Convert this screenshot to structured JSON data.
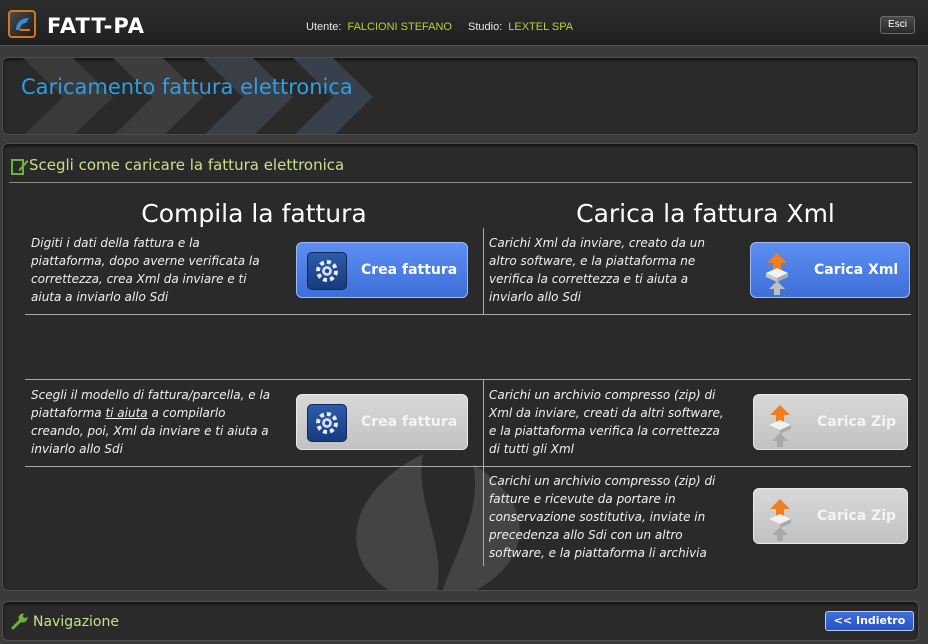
{
  "header": {
    "app_title": "FATT-PA",
    "user_label": "Utente:",
    "user_value": "FALCIONI STEFANO",
    "studio_label": "Studio:",
    "studio_value": "LEXTEL SPA",
    "exit_label": "Esci"
  },
  "page": {
    "title": "Caricamento fattura elettronica"
  },
  "section": {
    "title": "Scegli come caricare la fattura elettronica"
  },
  "left_column": {
    "heading": "Compila la fattura",
    "rows": [
      {
        "desc_1": "Digiti i dati della fattura e la",
        "desc_2": "piattaforma, dopo averne verificata la",
        "desc_3": "correttezza, crea Xml da inviare e ti",
        "desc_4": "aiuta a inviarlo allo Sdi",
        "button_label": "Crea fattura",
        "button_icon": "gear-icon",
        "enabled": true
      },
      {
        "desc_1a": "Scegli il modello di fattura/parcella, e la",
        "desc_2a": "piattaforma ",
        "desc_2link": "ti aiuta",
        "desc_2b": " a compilarlo",
        "desc_3": "creando, poi, Xml da inviare e ti aiuta a",
        "desc_4": "inviarlo allo Sdi",
        "button_label": "Crea fattura",
        "button_icon": "gear-icon",
        "enabled": false
      }
    ]
  },
  "right_column": {
    "heading": "Carica la fattura Xml",
    "rows": [
      {
        "desc_1": "Carichi Xml da inviare, creato da un",
        "desc_2": "altro software, e la piattaforma ne",
        "desc_3": "verifica la correttezza e ti aiuta a",
        "desc_4": "inviarlo allo Sdi",
        "button_label": "Carica Xml",
        "button_icon": "upload-icon",
        "enabled": true
      },
      {
        "desc_1": "Carichi un archivio compresso (zip) di",
        "desc_2": "Xml da inviare, creati da altri software,",
        "desc_3": "e la piattaforma verifica la correttezza",
        "desc_4": "di tutti gli Xml",
        "button_label": "Carica Zip",
        "button_icon": "upload-icon",
        "enabled": false
      },
      {
        "desc_1": "Carichi un archivio compresso (zip) di",
        "desc_2": "fatture e ricevute da portare in",
        "desc_3": "conservazione sostitutiva, inviate in",
        "desc_4": "precedenza allo Sdi con un altro",
        "desc_5": "software, e la piattaforma li archivia",
        "button_label": "Carica Zip",
        "button_icon": "upload-icon",
        "enabled": false
      }
    ]
  },
  "navigation": {
    "title": "Navigazione",
    "back_label": "<< Indietro"
  },
  "colors": {
    "accent_blue": "#2c9fe6",
    "section_green": "#c8e08a",
    "user_green": "#b5d334",
    "button_blue": "#4a7ee6",
    "button_disabled": "#cfcfcf"
  }
}
